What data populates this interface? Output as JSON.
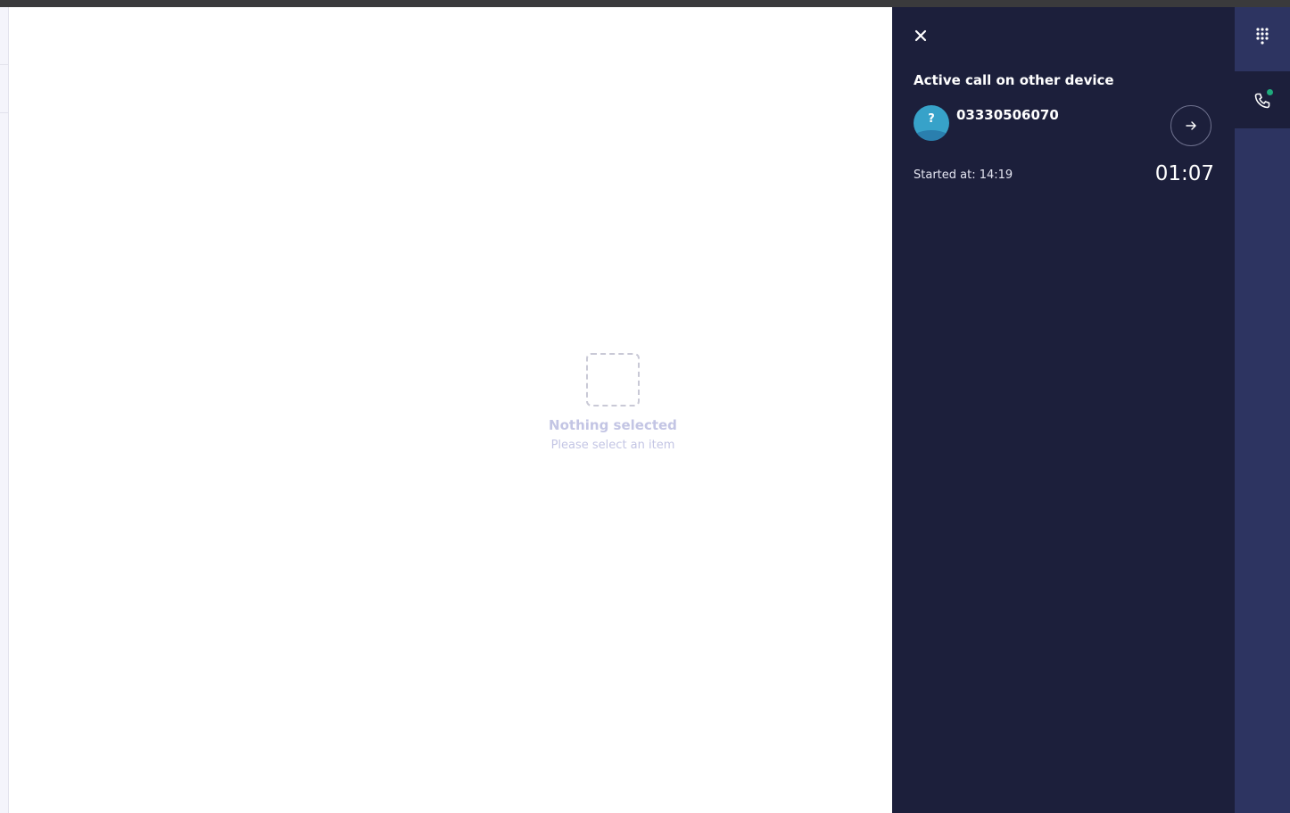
{
  "empty_state": {
    "title": "Nothing selected",
    "subtitle": "Please select an item"
  },
  "call_panel": {
    "close_icon": "close-icon",
    "title": "Active call on other device",
    "caller": {
      "avatar_mark": "?",
      "number": "03330506070"
    },
    "transfer_icon": "arrow-right-icon",
    "started_label": "Started at: 14:19",
    "duration": "01:07"
  },
  "rail": {
    "items": [
      {
        "icon": "dialpad-icon",
        "active": false
      },
      {
        "icon": "phone-icon",
        "active": true,
        "status_color": "#1faa7c"
      }
    ]
  },
  "colors": {
    "panel_bg": "#1c1f3b",
    "rail_bg": "#2d3461",
    "avatar": "#37a2c9",
    "empty_text": "#c3c5e4"
  }
}
